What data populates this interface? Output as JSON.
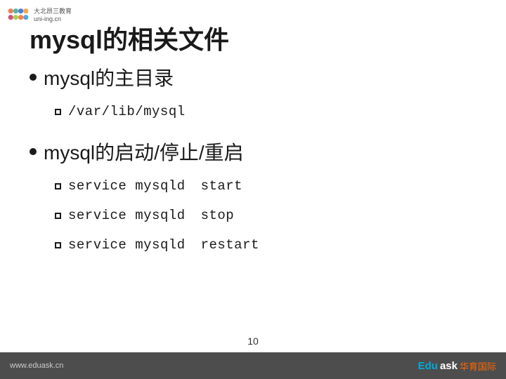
{
  "logo": {
    "url_text": "uni-ing.cn"
  },
  "title": "mysql的相关文件",
  "sections": [
    {
      "heading": "mysql的主目录",
      "sub_items": [
        {
          "text": "/var/lib/mysql",
          "type": "path"
        }
      ]
    },
    {
      "heading": "mysql的启动/停止/重启",
      "sub_items": [
        {
          "cmd": "service",
          "arg": "mysqld",
          "action": "start"
        },
        {
          "cmd": "service",
          "arg": "mysqld",
          "action": "stop"
        },
        {
          "cmd": "service",
          "arg": "mysqld",
          "action": "restart"
        }
      ]
    }
  ],
  "footer": {
    "url": "www.eduask.cn",
    "logo_edu": "Edu",
    "logo_ask": "ask",
    "logo_cn": "华育国际"
  },
  "page_number": "10"
}
